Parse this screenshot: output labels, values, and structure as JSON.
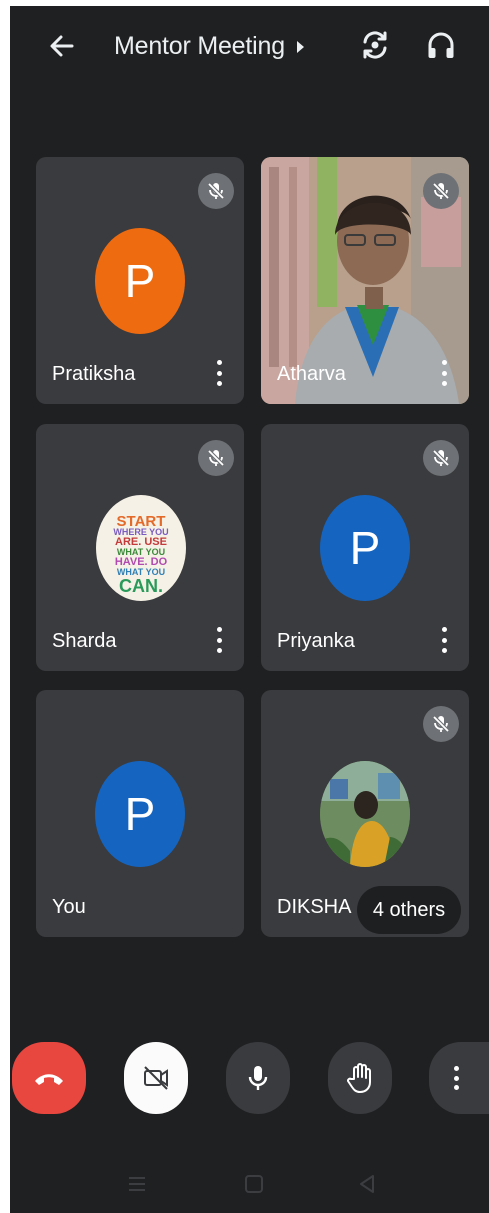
{
  "header": {
    "title": "Mentor Meeting",
    "icons": [
      "back-arrow-icon",
      "chevron-right-icon",
      "switch-camera-icon",
      "headphones-icon"
    ]
  },
  "participants": [
    {
      "name": "Pratiksha",
      "initial": "P",
      "avatar_color": "#ee6b10",
      "muted": true
    },
    {
      "name": "Atharva",
      "video_on": true,
      "muted": true
    },
    {
      "name": "Sharda",
      "avatar_text": [
        "START",
        "WHERE YOU",
        "ARE. USE",
        "WHAT YOU",
        "HAVE. DO",
        "WHAT YOU",
        "CAN."
      ],
      "muted": true
    },
    {
      "name": "Priyanka",
      "initial": "P",
      "avatar_color": "#1565c0",
      "muted": true
    },
    {
      "name": "You",
      "initial": "P",
      "avatar_color": "#1565c0",
      "muted": false
    },
    {
      "name": "DIKSHA",
      "muted": true,
      "others_label": "4 others"
    }
  ],
  "controls": {
    "icons": [
      "end-call-icon",
      "camera-off-icon",
      "microphone-icon",
      "raise-hand-icon",
      "more-options-icon"
    ],
    "colors": {
      "end_call": "#e8473f",
      "camera_btn": "#fbfbfb",
      "default_btn": "#3a3b3e"
    }
  },
  "system_nav": {
    "icons": [
      "recents-icon",
      "home-icon",
      "back-triangle-icon"
    ]
  },
  "colors": {
    "background": "#1f2022",
    "tile": "#3a3b3e",
    "mute_badge": "#6e7175"
  }
}
